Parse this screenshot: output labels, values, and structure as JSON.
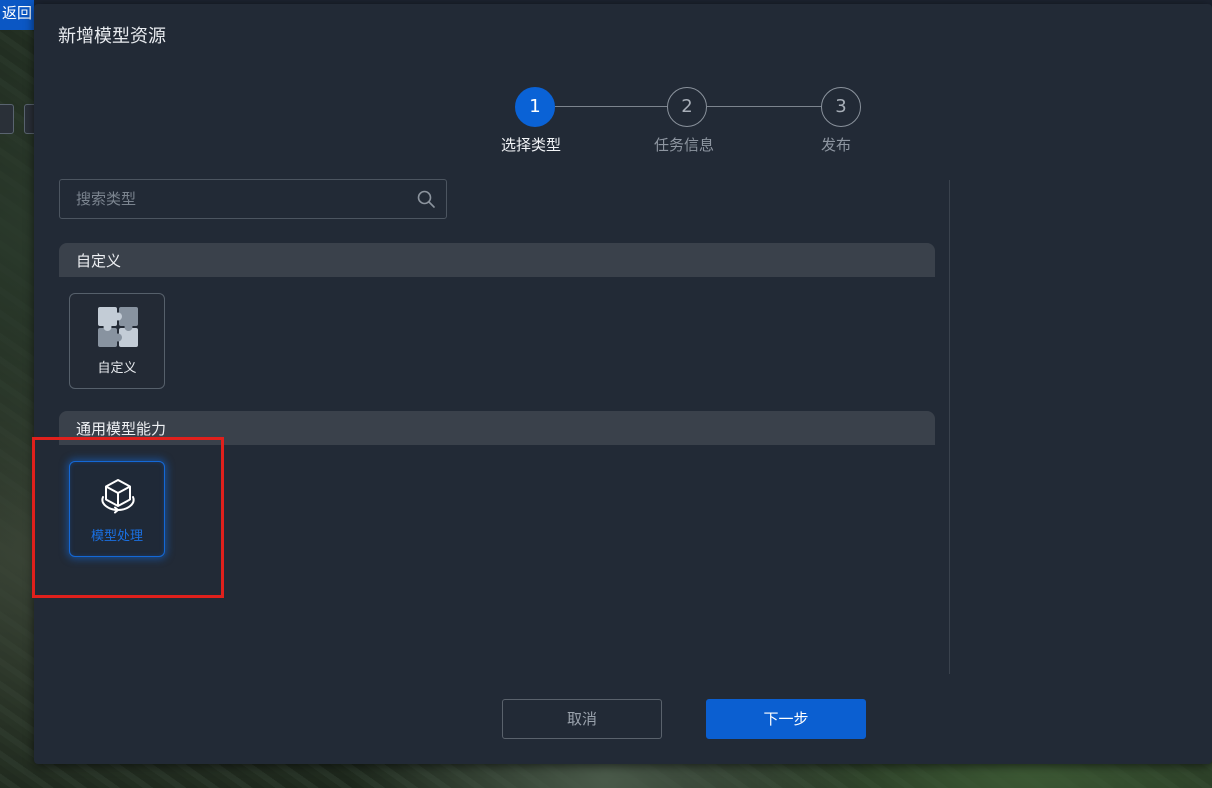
{
  "background": {
    "back_label": "返回"
  },
  "dialog": {
    "title": "新增模型资源"
  },
  "steps": [
    {
      "number": "1",
      "label": "选择类型",
      "state": "active"
    },
    {
      "number": "2",
      "label": "任务信息",
      "state": "idle"
    },
    {
      "number": "3",
      "label": "发布",
      "state": "idle"
    }
  ],
  "search": {
    "placeholder": "搜索类型",
    "value": ""
  },
  "sections": [
    {
      "title": "自定义",
      "cards": [
        {
          "label": "自定义",
          "icon": "puzzle-icon",
          "selected": false
        }
      ]
    },
    {
      "title": "通用模型能力",
      "cards": [
        {
          "label": "模型处理",
          "icon": "cube-icon",
          "selected": true
        }
      ]
    }
  ],
  "buttons": {
    "cancel": "取消",
    "next": "下一步"
  },
  "colors": {
    "accent": "#0b5fd1",
    "highlight": "#e0201c",
    "dialog_bg": "#222a36"
  }
}
